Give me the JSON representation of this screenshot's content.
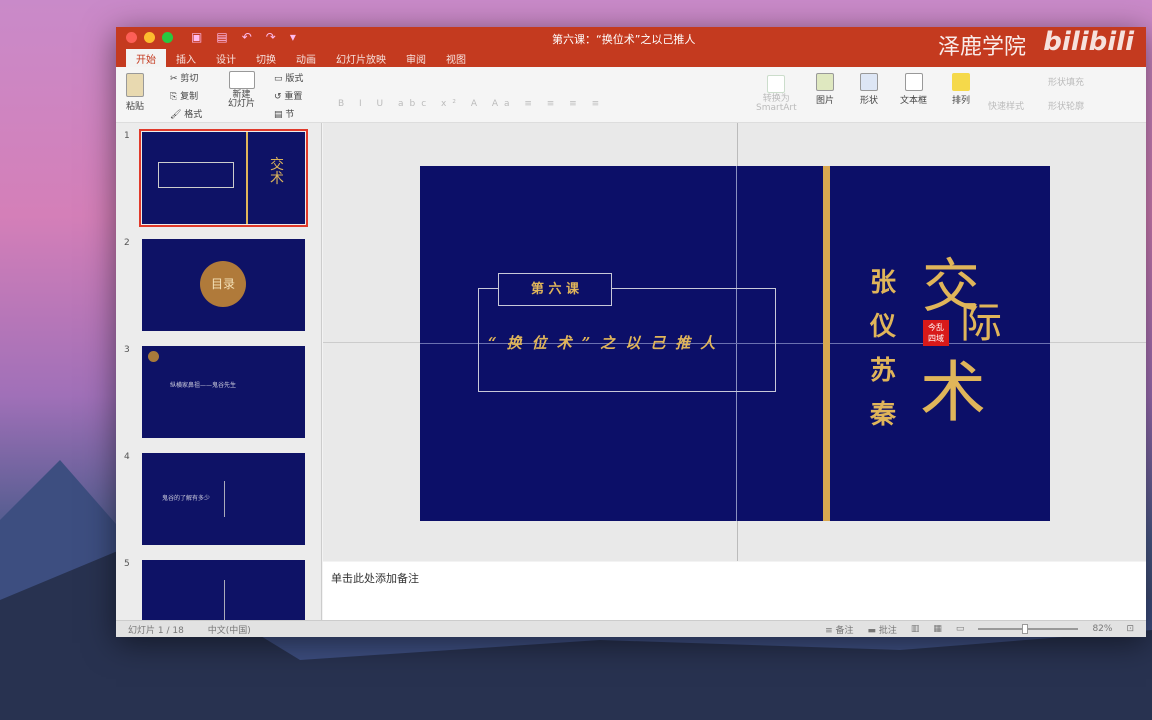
{
  "window": {
    "title": "第六课：“换位术”之以己推人",
    "watermark_brand": "泽鹿学院",
    "watermark_site": "bilibili"
  },
  "tabs": [
    "开始",
    "插入",
    "设计",
    "切换",
    "动画",
    "幻灯片放映",
    "审阅",
    "视图"
  ],
  "ribbon": {
    "paste": "粘贴",
    "cut": "剪切",
    "copy": "复制",
    "format": "格式",
    "new_slide": "新建\n幻灯片",
    "layout": "版式",
    "reset": "重置",
    "section": "节",
    "smartart": "转换为\nSmartArt",
    "picture": "图片",
    "shape": "形状",
    "textbox": "文本框",
    "arrange": "排列",
    "quick_styles": "快速样式",
    "shape_fill": "形状填充",
    "shape_outline": "形状轮廓"
  },
  "slides": [
    {
      "number": "1"
    },
    {
      "number": "2",
      "badge": "目录"
    },
    {
      "number": "3",
      "text": "纵横家鼻祖——鬼谷先生"
    },
    {
      "number": "4",
      "text": "鬼谷的了解有多少"
    },
    {
      "number": "5"
    }
  ],
  "slide": {
    "lesson": "第 六 课",
    "subtitle": "“换位术”之以己推人",
    "names": [
      "张",
      "仪",
      "苏",
      "秦"
    ],
    "title_chars": [
      "交",
      "际",
      "术"
    ],
    "seal": "今乱\n四域"
  },
  "notes": {
    "placeholder": "单击此处添加备注"
  },
  "status": {
    "slide_count": "幻灯片 1 / 18",
    "language": "中文(中国)",
    "notes_btn": "备注",
    "comments_btn": "批注",
    "zoom": "82%"
  }
}
